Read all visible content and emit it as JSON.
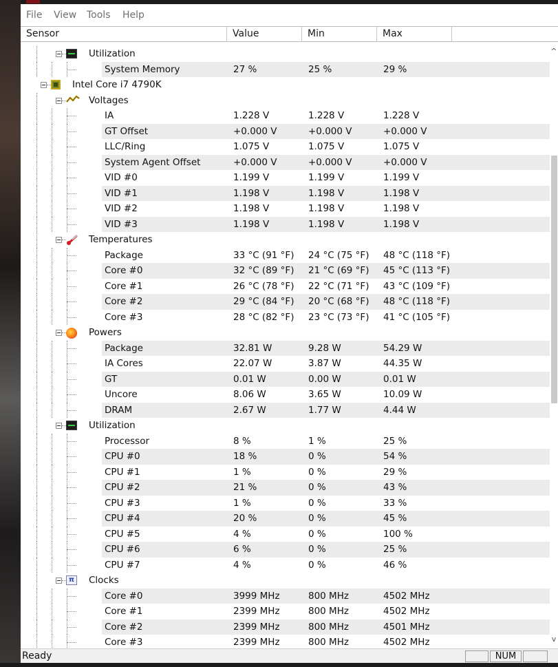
{
  "menu": [
    "File",
    "View",
    "Tools",
    "Help"
  ],
  "columns": {
    "sensor": "Sensor",
    "value": "Value",
    "min": "Min",
    "max": "Max"
  },
  "rows": [
    {
      "name": "Utilization",
      "value": "",
      "min": "",
      "max": "",
      "level": 2,
      "type": "node",
      "icon": "utilization-icon"
    },
    {
      "name": "System Memory",
      "value": "27 %",
      "min": "25 %",
      "max": "29 %",
      "level": 3,
      "type": "leaf"
    },
    {
      "name": "Intel Core i7 4790K",
      "value": "",
      "min": "",
      "max": "",
      "level": 1,
      "type": "node",
      "icon": "cpu-chip-icon"
    },
    {
      "name": "Voltages",
      "value": "",
      "min": "",
      "max": "",
      "level": 2,
      "type": "node",
      "icon": "voltage-icon"
    },
    {
      "name": "IA",
      "value": "1.228 V",
      "min": "1.228 V",
      "max": "1.228 V",
      "level": 3,
      "type": "leaf"
    },
    {
      "name": "GT Offset",
      "value": "+0.000 V",
      "min": "+0.000 V",
      "max": "+0.000 V",
      "level": 3,
      "type": "leaf"
    },
    {
      "name": "LLC/Ring",
      "value": "1.075 V",
      "min": "1.075 V",
      "max": "1.075 V",
      "level": 3,
      "type": "leaf"
    },
    {
      "name": "System Agent Offset",
      "value": "+0.000 V",
      "min": "+0.000 V",
      "max": "+0.000 V",
      "level": 3,
      "type": "leaf"
    },
    {
      "name": "VID #0",
      "value": "1.199 V",
      "min": "1.199 V",
      "max": "1.199 V",
      "level": 3,
      "type": "leaf"
    },
    {
      "name": "VID #1",
      "value": "1.198 V",
      "min": "1.198 V",
      "max": "1.198 V",
      "level": 3,
      "type": "leaf"
    },
    {
      "name": "VID #2",
      "value": "1.198 V",
      "min": "1.198 V",
      "max": "1.198 V",
      "level": 3,
      "type": "leaf"
    },
    {
      "name": "VID #3",
      "value": "1.198 V",
      "min": "1.198 V",
      "max": "1.198 V",
      "level": 3,
      "type": "leaf"
    },
    {
      "name": "Temperatures",
      "value": "",
      "min": "",
      "max": "",
      "level": 2,
      "type": "node",
      "icon": "thermometer-icon"
    },
    {
      "name": "Package",
      "value": "33 °C  (91 °F)",
      "min": "24 °C  (75 °F)",
      "max": "48 °C  (118 °F)",
      "level": 3,
      "type": "leaf"
    },
    {
      "name": "Core #0",
      "value": "32 °C  (89 °F)",
      "min": "21 °C  (69 °F)",
      "max": "45 °C  (113 °F)",
      "level": 3,
      "type": "leaf"
    },
    {
      "name": "Core #1",
      "value": "26 °C  (78 °F)",
      "min": "22 °C  (71 °F)",
      "max": "43 °C  (109 °F)",
      "level": 3,
      "type": "leaf"
    },
    {
      "name": "Core #2",
      "value": "29 °C  (84 °F)",
      "min": "20 °C  (68 °F)",
      "max": "48 °C  (118 °F)",
      "level": 3,
      "type": "leaf"
    },
    {
      "name": "Core #3",
      "value": "28 °C  (82 °F)",
      "min": "23 °C  (73 °F)",
      "max": "41 °C  (105 °F)",
      "level": 3,
      "type": "leaf"
    },
    {
      "name": "Powers",
      "value": "",
      "min": "",
      "max": "",
      "level": 2,
      "type": "node",
      "icon": "power-icon"
    },
    {
      "name": "Package",
      "value": "32.81 W",
      "min": "9.28 W",
      "max": "54.29 W",
      "level": 3,
      "type": "leaf"
    },
    {
      "name": "IA Cores",
      "value": "22.07 W",
      "min": "3.87 W",
      "max": "44.35 W",
      "level": 3,
      "type": "leaf"
    },
    {
      "name": "GT",
      "value": "0.01 W",
      "min": "0.00 W",
      "max": "0.01 W",
      "level": 3,
      "type": "leaf"
    },
    {
      "name": "Uncore",
      "value": "8.06 W",
      "min": "3.65 W",
      "max": "10.09 W",
      "level": 3,
      "type": "leaf"
    },
    {
      "name": "DRAM",
      "value": "2.67 W",
      "min": "1.77 W",
      "max": "4.44 W",
      "level": 3,
      "type": "leaf"
    },
    {
      "name": "Utilization",
      "value": "",
      "min": "",
      "max": "",
      "level": 2,
      "type": "node",
      "icon": "utilization-icon"
    },
    {
      "name": "Processor",
      "value": "8 %",
      "min": "1 %",
      "max": "25 %",
      "level": 3,
      "type": "leaf"
    },
    {
      "name": "CPU #0",
      "value": "18 %",
      "min": "0 %",
      "max": "54 %",
      "level": 3,
      "type": "leaf"
    },
    {
      "name": "CPU #1",
      "value": "1 %",
      "min": "0 %",
      "max": "29 %",
      "level": 3,
      "type": "leaf"
    },
    {
      "name": "CPU #2",
      "value": "21 %",
      "min": "0 %",
      "max": "43 %",
      "level": 3,
      "type": "leaf"
    },
    {
      "name": "CPU #3",
      "value": "1 %",
      "min": "0 %",
      "max": "33 %",
      "level": 3,
      "type": "leaf"
    },
    {
      "name": "CPU #4",
      "value": "20 %",
      "min": "0 %",
      "max": "45 %",
      "level": 3,
      "type": "leaf"
    },
    {
      "name": "CPU #5",
      "value": "4 %",
      "min": "0 %",
      "max": "100 %",
      "level": 3,
      "type": "leaf"
    },
    {
      "name": "CPU #6",
      "value": "6 %",
      "min": "0 %",
      "max": "25 %",
      "level": 3,
      "type": "leaf"
    },
    {
      "name": "CPU #7",
      "value": "4 %",
      "min": "0 %",
      "max": "46 %",
      "level": 3,
      "type": "leaf"
    },
    {
      "name": "Clocks",
      "value": "",
      "min": "",
      "max": "",
      "level": 2,
      "type": "node",
      "icon": "clock-icon"
    },
    {
      "name": "Core #0",
      "value": "3999 MHz",
      "min": "800 MHz",
      "max": "4502 MHz",
      "level": 3,
      "type": "leaf"
    },
    {
      "name": "Core #1",
      "value": "2399 MHz",
      "min": "800 MHz",
      "max": "4502 MHz",
      "level": 3,
      "type": "leaf"
    },
    {
      "name": "Core #2",
      "value": "2399 MHz",
      "min": "800 MHz",
      "max": "4501 MHz",
      "level": 3,
      "type": "leaf"
    },
    {
      "name": "Core #3",
      "value": "2399 MHz",
      "min": "800 MHz",
      "max": "4502 MHz",
      "level": 3,
      "type": "leaf"
    }
  ],
  "status": {
    "text": "Ready",
    "num": "NUM"
  },
  "colors": {
    "alt_row": "#ebebeb",
    "utilization_graph": "#3bd24a"
  }
}
